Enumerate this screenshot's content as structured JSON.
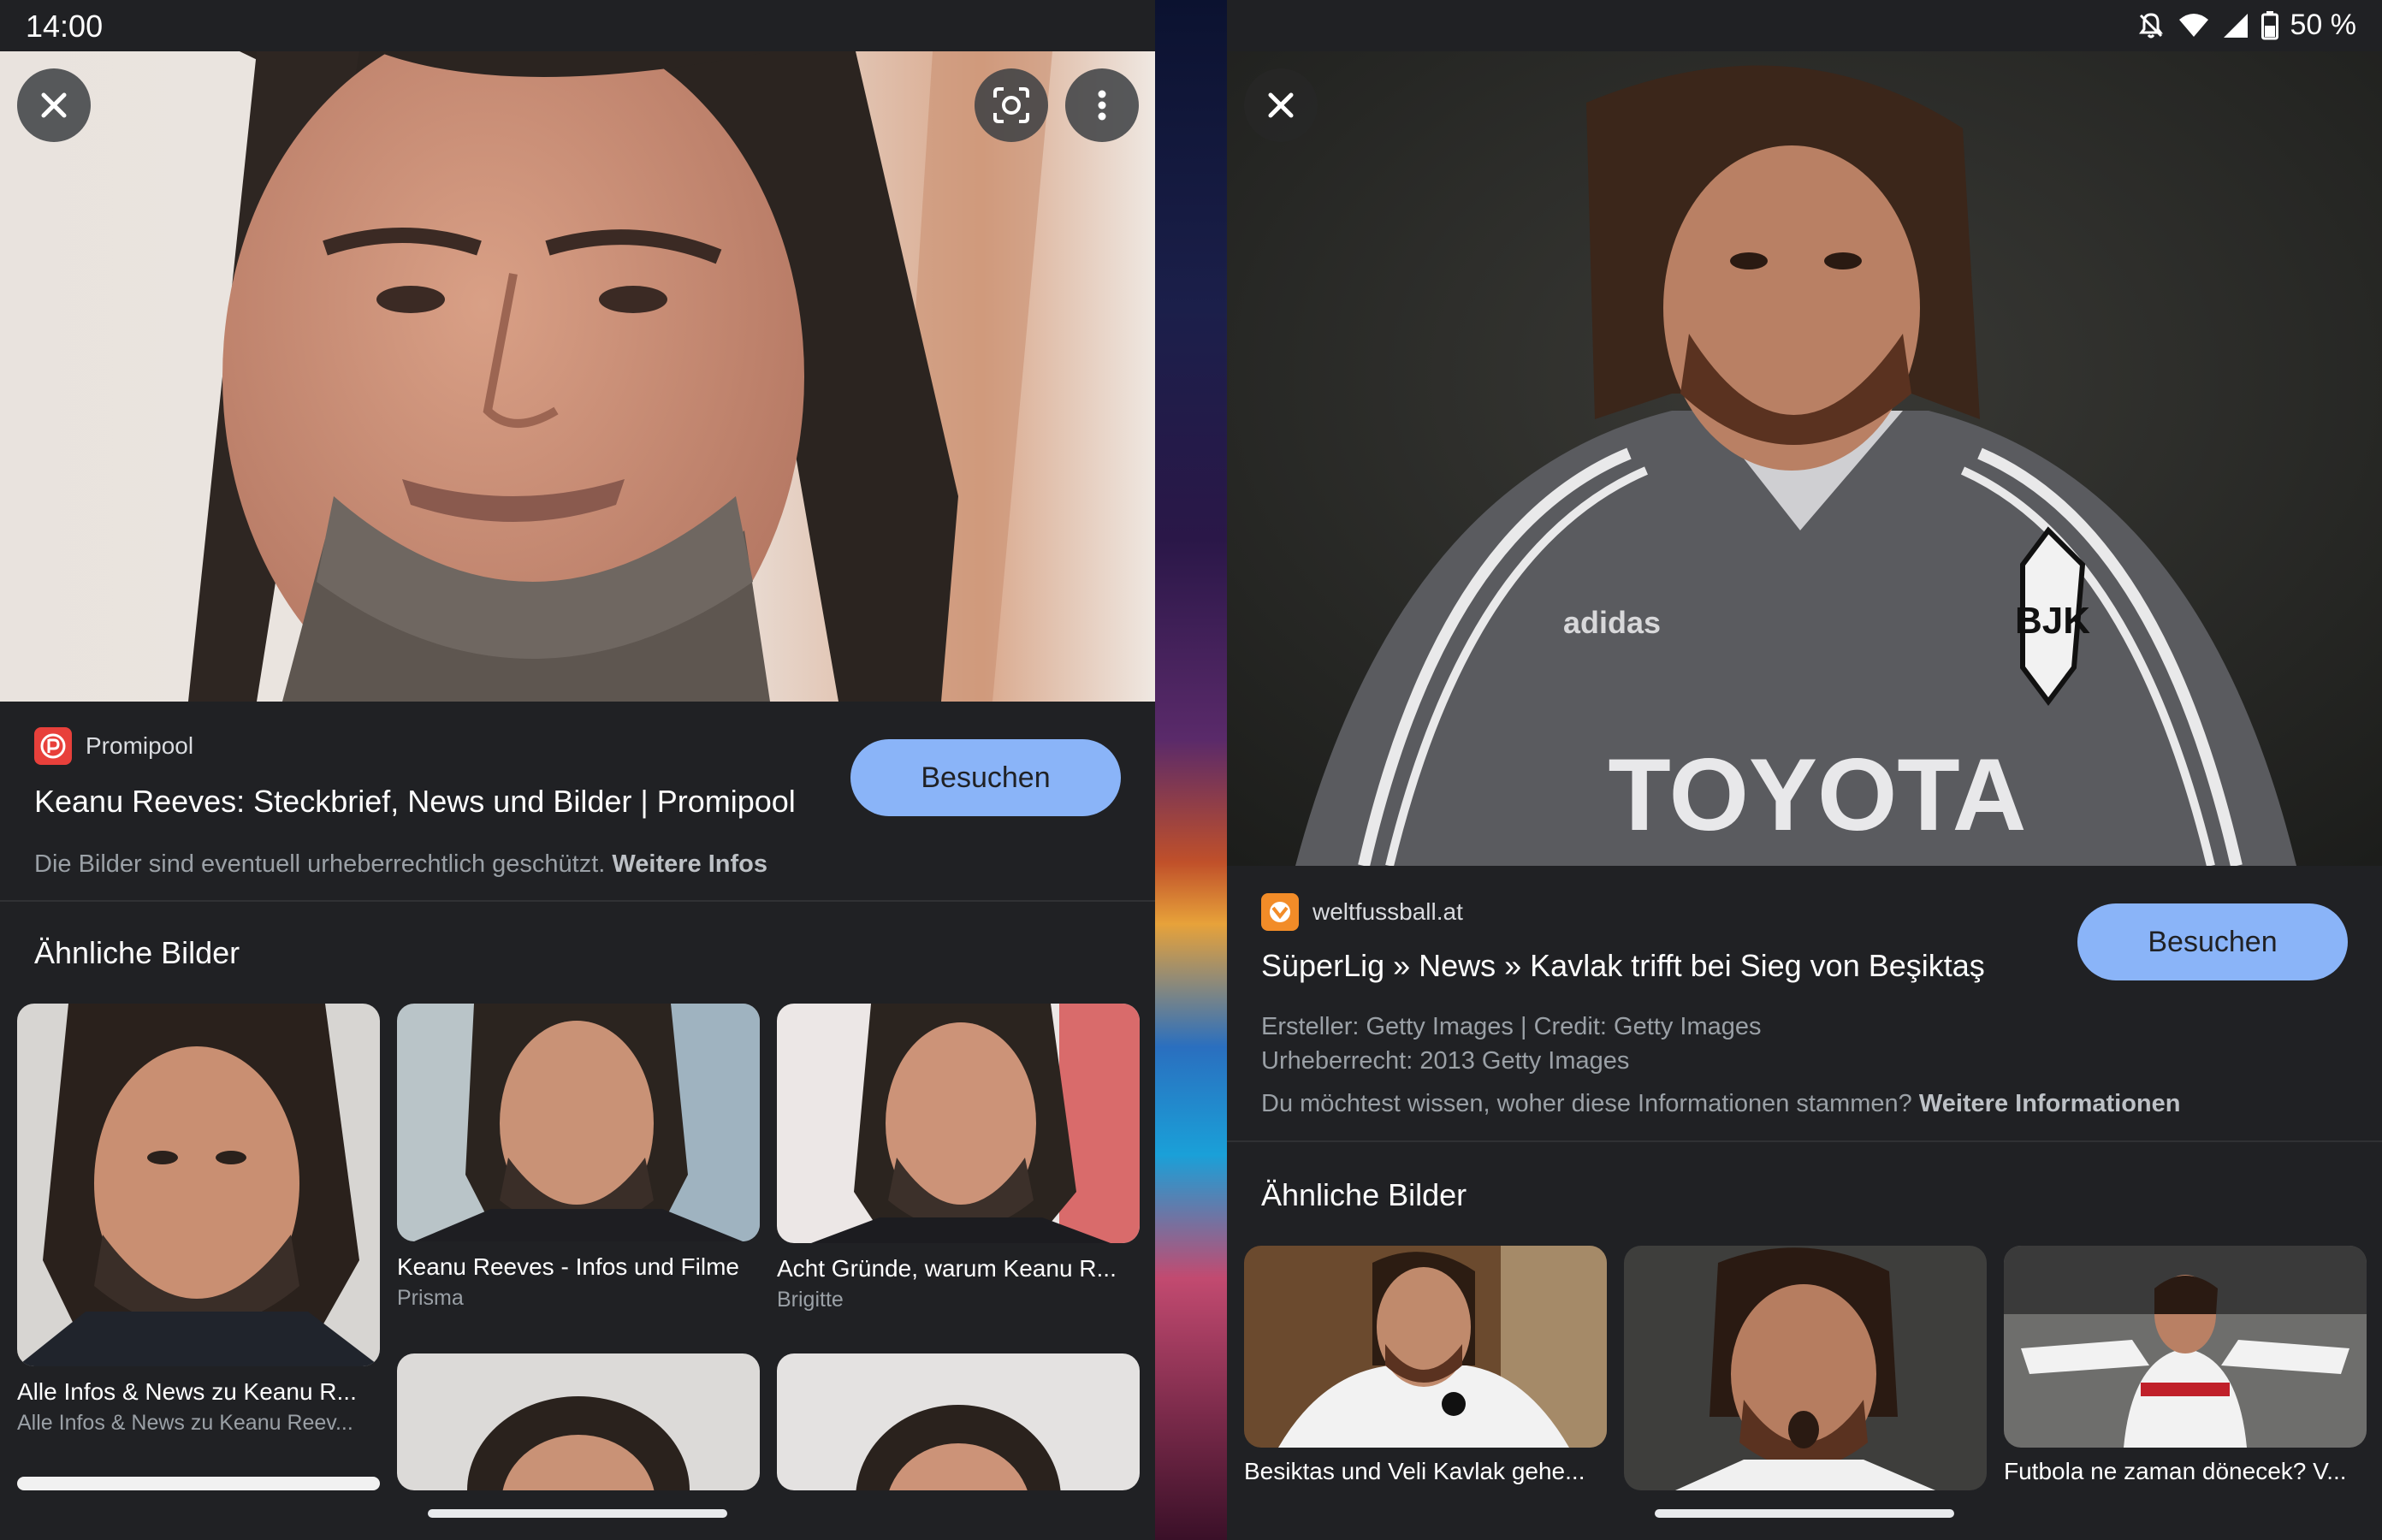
{
  "status": {
    "time": "14:00",
    "battery": "50 %"
  },
  "icons": {
    "close": "close-icon",
    "lens": "lens-icon",
    "more": "more-vert-icon"
  },
  "left": {
    "result": {
      "site_name": "Promipool",
      "title": "Keanu Reeves: Steckbrief, News und Bilder | Promipool",
      "visit_label": "Besuchen",
      "copyright_text": "Die Bilder sind eventuell urheberrechtlich geschützt.",
      "more_info_link": "Weitere Infos"
    },
    "similar_title": "Ähnliche Bilder",
    "similar": [
      {
        "caption": "Alle Infos & News zu Keanu R...",
        "source": "Alle Infos & News zu Keanu Reev..."
      },
      {
        "caption": "Keanu Reeves - Infos und Filme",
        "source": "Prisma"
      },
      {
        "caption": "Acht Gründe, warum Keanu R...",
        "source": "Brigitte"
      }
    ]
  },
  "right": {
    "result": {
      "site_name": "weltfussball.at",
      "title": "SüperLig » News » Kavlak trifft bei Sieg von Beşiktaş",
      "visit_label": "Besuchen",
      "creator_line": "Ersteller: Getty Images | Credit: Getty Images",
      "copyright_line": "Urheberrecht: 2013 Getty Images",
      "source_question": "Du möchtest wissen, woher diese Informationen stammen?",
      "more_info_link": "Weitere Informationen"
    },
    "similar_title": "Ähnliche Bilder",
    "similar": [
      {
        "caption": "Besiktas und Veli Kavlak gehe..."
      },
      {
        "caption": ""
      },
      {
        "caption": "Futbola ne zaman dönecek? V..."
      }
    ]
  },
  "colors": {
    "background": "#202124",
    "button": "#8ab4f8",
    "promipool_red": "#e8403b",
    "weltfussball_orange": "#f28c28"
  }
}
